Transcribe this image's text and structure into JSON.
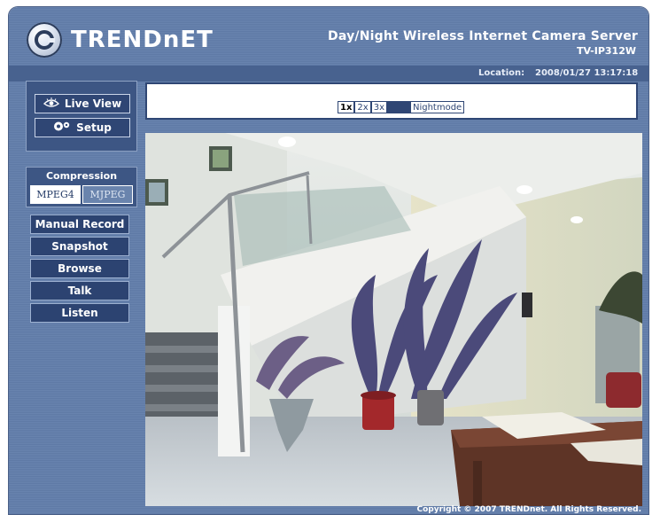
{
  "brand": {
    "logo_text": "TRENDnET"
  },
  "header": {
    "product_title": "Day/Night Wireless Internet Camera Server",
    "model": "TV-IP312W",
    "location_label": "Location:",
    "timestamp": "2008/01/27 13:17:18"
  },
  "nav": {
    "live_view": "Live View",
    "setup": "Setup"
  },
  "compression": {
    "title": "Compression",
    "options": [
      "MPEG4",
      "MJPEG"
    ],
    "selected": "MPEG4"
  },
  "actions": [
    "Manual Record",
    "Snapshot",
    "Browse",
    "Talk",
    "Listen"
  ],
  "toolbar": {
    "zoom": [
      "1x",
      "2x",
      "3x"
    ],
    "selected_zoom": "1x",
    "nightmode": "Nightmode"
  },
  "footer": {
    "copyright": "Copyright © 2007 TRENDnet. All Rights Reserved."
  },
  "colors": {
    "frame": "#6883ae",
    "panel": "#3d5684",
    "button": "#2c4371",
    "toolbar_border": "#2f4674"
  }
}
